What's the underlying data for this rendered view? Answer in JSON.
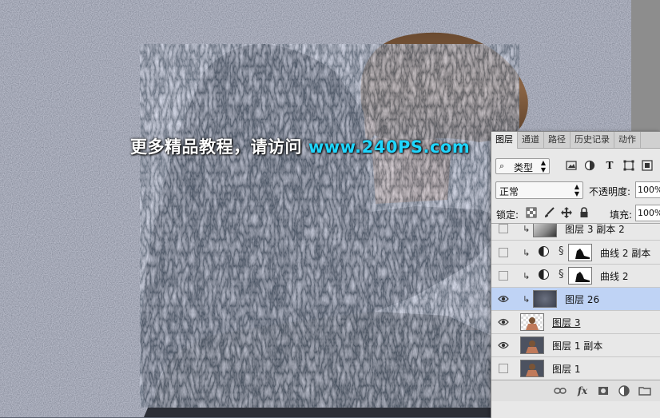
{
  "watermark": {
    "prefix": "更多精品教程，请访问 ",
    "url": "www.240PS.com"
  },
  "layers_panel": {
    "tabs": [
      "图层",
      "通道",
      "路径",
      "历史记录",
      "动作"
    ],
    "active_tab": "图层",
    "filter": {
      "icon": "search-icon",
      "value": "类型"
    },
    "filter_icons": [
      "image-filter-icon",
      "adjustment-filter-icon",
      "text-filter-icon",
      "shape-filter-icon",
      "smart-object-filter-icon"
    ],
    "blend_mode": "正常",
    "opacity_label": "不透明度:",
    "opacity_value": "100%",
    "lock_label": "锁定:",
    "lock_icons": [
      "lock-transparent-icon",
      "lock-paint-icon",
      "lock-move-icon",
      "lock-all-icon"
    ],
    "fill_label": "填充:",
    "fill_value": "100%",
    "layers": [
      {
        "name": "图层 3 副本 2",
        "visible": false,
        "clipped": true,
        "adjustment": false,
        "selected": false
      },
      {
        "name": "曲线 2 副本",
        "visible": false,
        "clipped": true,
        "adjustment": true,
        "selected": false
      },
      {
        "name": "曲线 2",
        "visible": false,
        "clipped": true,
        "adjustment": true,
        "selected": false
      },
      {
        "name": "图层 26",
        "visible": true,
        "clipped": true,
        "adjustment": false,
        "selected": true
      },
      {
        "name": "图层 3",
        "visible": true,
        "clipped": false,
        "adjustment": false,
        "selected": false
      },
      {
        "name": "图层 1 副本",
        "visible": true,
        "clipped": false,
        "adjustment": false,
        "selected": false
      },
      {
        "name": "图层 1",
        "visible": false,
        "clipped": false,
        "adjustment": false,
        "selected": false
      }
    ],
    "footer_icons": [
      "link-layers-icon",
      "fx-icon",
      "add-mask-icon",
      "new-adjustment-icon",
      "new-group-icon"
    ],
    "footer_fx": "fx"
  },
  "colors": {
    "selected_row": "#bfd3f5",
    "watermark_url": "#1fd6ff",
    "panel_bg": "#e8e8e8"
  }
}
